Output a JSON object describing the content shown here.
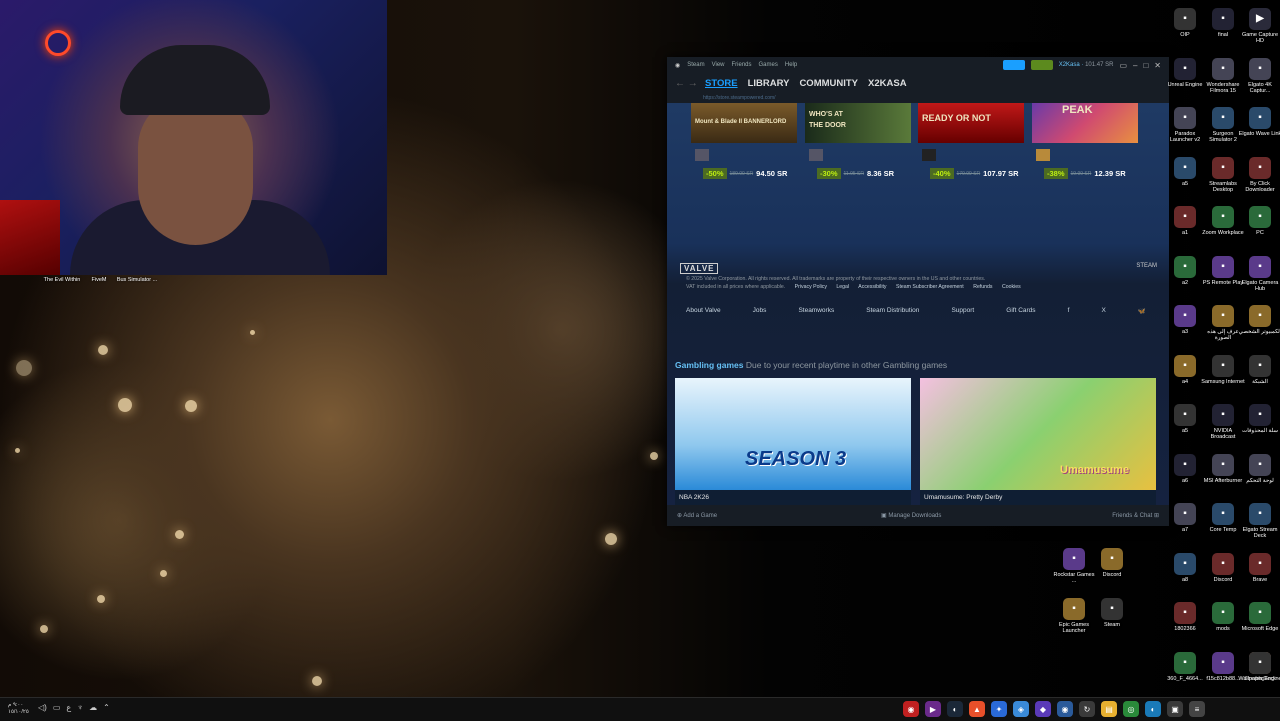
{
  "webcam_labels": {
    "item1": "The Evil Within",
    "item2": "FiveM",
    "item3": "Bus Simulator ..."
  },
  "steam": {
    "titlebar_menu": [
      "Steam",
      "View",
      "Friends",
      "Games",
      "Help"
    ],
    "account": "X2Kasa",
    "balance": "101.47 SR",
    "nav_tabs": [
      "STORE",
      "LIBRARY",
      "COMMUNITY",
      "X2KASA"
    ],
    "url": "https://store.steampowered.com/",
    "games": [
      {
        "title": "Mount & Blade II BANNERLORD",
        "discount": "-50%",
        "original": "189.00 SR",
        "final": "94.50 SR"
      },
      {
        "title": "WHO'S AT THE DOOR",
        "discount": "-30%",
        "original": "11.95 SR",
        "final": "8.36 SR"
      },
      {
        "title": "READY OR NOT",
        "discount": "-40%",
        "original": "179.99 SR",
        "final": "107.97 SR"
      },
      {
        "title": "PEAK",
        "discount": "-38%",
        "original": "19.99 SR",
        "final": "12.39 SR"
      }
    ],
    "footer": {
      "valve": "VALVE",
      "steam_logo": "STEAM",
      "copyright": "© 2025 Valve Corporation. All rights reserved. All trademarks are property of their respective owners in the US and other countries.",
      "vat": "VAT included in all prices where applicable.",
      "legal_links": [
        "Privacy Policy",
        "Legal",
        "Accessibility",
        "Steam Subscriber Agreement",
        "Refunds",
        "Cookies"
      ],
      "links": [
        "About Valve",
        "Jobs",
        "Steamworks",
        "Steam Distribution",
        "Support",
        "Gift Cards",
        "f",
        "X",
        "Bluesky"
      ]
    },
    "gambling": {
      "title": "Gambling games",
      "subtitle": "Due to your recent playtime in other Gambling games",
      "cards": [
        {
          "name": "NBA 2K26",
          "art_text": "SEASON 3"
        },
        {
          "name": "Umamusume: Pretty Derby",
          "art_text": "Umamusume"
        }
      ]
    },
    "bottom": {
      "add_game": "Add a Game",
      "manage_downloads": "Manage Downloads",
      "friends_chat": "Friends & Chat"
    }
  },
  "desktop_icons": {
    "col1": [
      "OIP",
      "Unreal Engine",
      "Paradox Launcher v2",
      "a5",
      "a1",
      "a2",
      "a3",
      "a4",
      "a5",
      "a6",
      "a7",
      "a8",
      "1802366",
      "360_F_4664...",
      "Rockstar Games ...",
      "Epic Games Launcher"
    ],
    "col2": [
      "final",
      "Wondershare Filmora 15",
      "Surgeon Simulator 2",
      "Streamlabs Desktop",
      "Zoom Workplace",
      "PS Remote Play",
      "عرف إلى هذه الصورة",
      "Samsung Internet",
      "NVIDIA Broadcast",
      "MSI Afterburner",
      "Core Temp",
      "Discord",
      "mods",
      "f15c812b88...",
      "Discord",
      "Steam"
    ],
    "col3": [
      "Elgato 4K Captur...",
      "Elgato Wave Link",
      "By Click Downloader",
      "PC",
      "Elgato Camera Hub",
      "الكمبيوتر الشخصي",
      "الشبكة",
      "سلة المحذوفات",
      "لوحة التحكم",
      "Elgato Stream Deck",
      "Brave",
      "Microsoft Edge",
      "Stream Deck",
      "hhg",
      "Wallpaper Engine"
    ],
    "col4": [
      "Game Capture HD"
    ]
  },
  "taskbar": {
    "time": "٩:٠٠ م",
    "date": "١٥/١٠/٢٥",
    "lang": "ع"
  }
}
